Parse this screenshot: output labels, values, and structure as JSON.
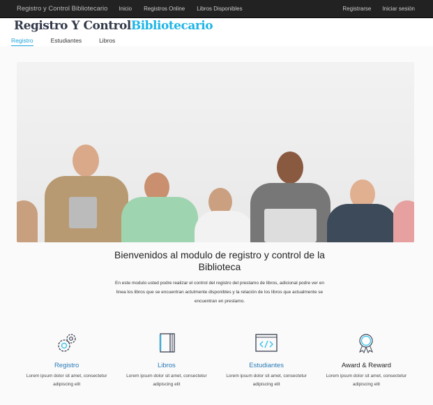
{
  "topbar": {
    "brand": "Registro y Control Bibliotecario",
    "links": [
      "Inicio",
      "Registros Online",
      "Libros Disponibles"
    ],
    "right": [
      "Registrarse",
      "Iniciar sesión"
    ]
  },
  "header": {
    "title_dark": "Registro Y Control",
    "title_accent": "Bibliotecario",
    "tabs": [
      "Registro",
      "Estudiantes",
      "Libros"
    ]
  },
  "main": {
    "welcome": "Bienvenidos al modulo de registro y control de la Biblioteca",
    "description": "En este modulo usted podre realizar el control del registro del prestamo de libros, adicional podre ver en linea los libros que se encuentran actulmente disponibles y la relación de los libros que actualmente se encuentran en prestamo."
  },
  "features": [
    {
      "icon": "gears-icon",
      "title": "Registro",
      "text": "Lorem ipsum dolor sit amet, consectetur adipiscing elit"
    },
    {
      "icon": "notebook-icon",
      "title": "Libros",
      "text": "Lorem ipsum dolor sit amet, consectetur adipiscing elit"
    },
    {
      "icon": "code-window-icon",
      "title": "Estudiantes",
      "text": "Lorem ipsum dolor sit amet, consectetur adipiscing elit"
    },
    {
      "icon": "award-icon",
      "title": "Award & Reward",
      "text": "Lorem ipsum dolor sit amet, consectetur adipiscing elit"
    }
  ],
  "colors": {
    "accent": "#1fb5e6",
    "link": "#2a7ab8",
    "topbar": "#222222"
  }
}
